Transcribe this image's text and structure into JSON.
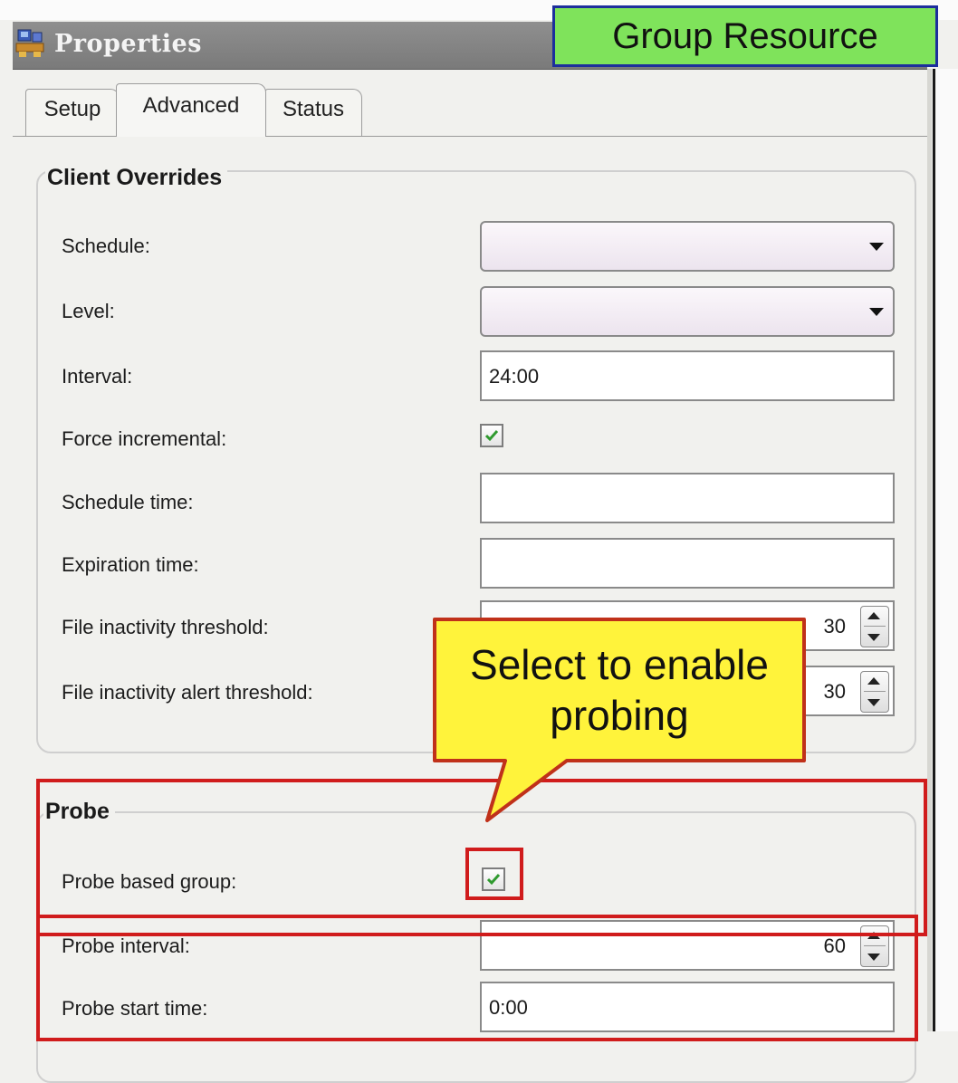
{
  "window": {
    "title": "Properties",
    "icon": "properties-app-icon"
  },
  "banner": {
    "text": "Group Resource",
    "background": "#7fe35b",
    "border": "#1c2e9c"
  },
  "tabs": [
    {
      "label": "Setup",
      "active": false
    },
    {
      "label": "Advanced",
      "active": true
    },
    {
      "label": "Status",
      "active": false
    }
  ],
  "client_overrides": {
    "legend": "Client Overrides",
    "schedule": {
      "label": "Schedule:",
      "value": ""
    },
    "level": {
      "label": "Level:",
      "value": ""
    },
    "interval": {
      "label": "Interval:",
      "value": "24:00"
    },
    "force_incremental": {
      "label": "Force incremental:",
      "checked": true
    },
    "schedule_time": {
      "label": "Schedule time:",
      "value": ""
    },
    "expiration_time": {
      "label": "Expiration time:",
      "value": ""
    },
    "file_inactivity_threshold": {
      "label": "File inactivity threshold:",
      "value": "30"
    },
    "file_inactivity_alert_threshold": {
      "label": "File inactivity alert threshold:",
      "value": "30"
    }
  },
  "probe": {
    "legend": "Probe",
    "probe_based_group": {
      "label": "Probe based group:",
      "checked": true
    },
    "probe_interval": {
      "label": "Probe interval:",
      "value": "60"
    },
    "probe_start_time": {
      "label": "Probe start time:",
      "value": "0:00"
    }
  },
  "callout": {
    "line1": "Select to enable",
    "line2": "probing",
    "background": "#fff33b",
    "border": "#c0311a"
  },
  "colors": {
    "highlight_box": "#d01c1c",
    "checkmark": "#2f9a2f"
  }
}
